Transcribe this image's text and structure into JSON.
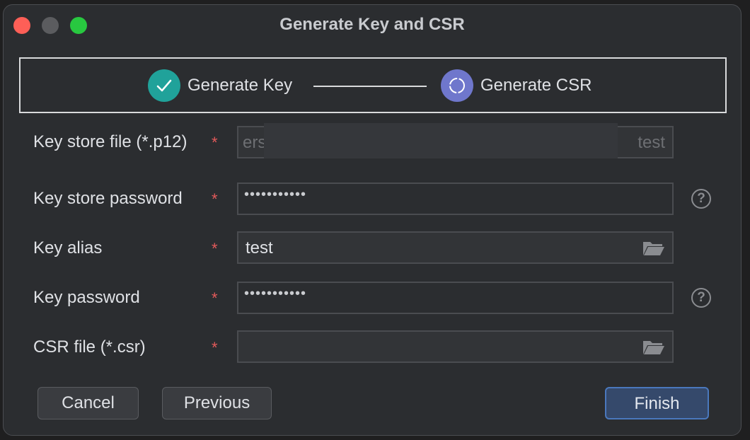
{
  "window": {
    "title": "Generate Key and CSR"
  },
  "steps": [
    {
      "label": "Generate Key",
      "status": "done"
    },
    {
      "label": "Generate CSR",
      "status": "current"
    }
  ],
  "form": {
    "required_mark": "*",
    "fields": [
      {
        "label": "Key store file (*.p12)",
        "value_start": "ers",
        "value_end": "test"
      },
      {
        "label": "Key store password",
        "value": "•••••••••••"
      },
      {
        "label": "Key alias",
        "value": "test"
      },
      {
        "label": "Key password",
        "value": "•••••••••••"
      },
      {
        "label": "CSR file (*.csr)",
        "value": ""
      }
    ],
    "help_glyph": "?"
  },
  "buttons": {
    "cancel": "Cancel",
    "previous": "Previous",
    "finish": "Finish"
  },
  "colors": {
    "step_done": "#20a29a",
    "step_current": "#6f77cc",
    "required": "#e35a5a",
    "primary_button": "#35496b"
  },
  "icons": {
    "step_done": "checkmark-icon",
    "step_current": "refresh-ring-icon",
    "help": "question-circle-icon",
    "browse": "folder-icon"
  }
}
